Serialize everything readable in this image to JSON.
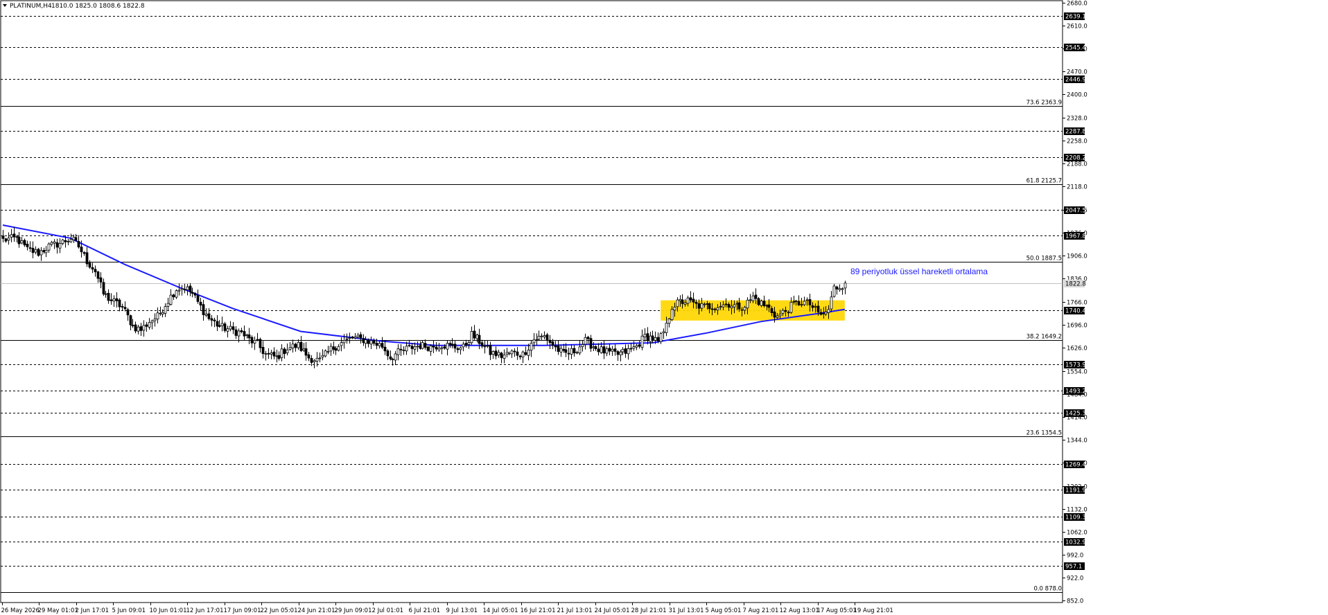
{
  "header": {
    "symbol": "PLATINUM,H4",
    "ohlc": "1810.0 1825.0 1808.6 1822.8"
  },
  "annotation": "89 periyotluk üssel hareketli ortalama",
  "chart_data": {
    "type": "candlestick",
    "title": "PLATINUM,H4",
    "ylim": [
      852,
      2680
    ],
    "current_price": 1822.8,
    "y_ticks": [
      2680.0,
      2610.0,
      2540.0,
      2470.0,
      2400.0,
      2328.0,
      2258.0,
      2188.0,
      2118.0,
      2047.5,
      1976.0,
      1906.0,
      1836.0,
      1766.0,
      1696.0,
      1626.0,
      1554.0,
      1484.0,
      1414.0,
      1344.0,
      1274.0,
      1202.0,
      1132.0,
      1062.0,
      992.0,
      922.0,
      852.0
    ],
    "x_labels": [
      "26 May 2026",
      "29 May 01:01",
      "2 Jun 17:01",
      "5 Jun 09:01",
      "10 Jun 01:01",
      "12 Jun 17:01",
      "17 Jun 09:01",
      "22 Jun 05:01",
      "24 Jun 21:01",
      "29 Jun 09:01",
      "2 Jul 01:01",
      "6 Jul 21:01",
      "9 Jul 13:01",
      "14 Jul 05:01",
      "16 Jul 21:01",
      "21 Jul 13:01",
      "24 Jul 05:01",
      "28 Jul 21:01",
      "31 Jul 13:01",
      "5 Aug 05:01",
      "7 Aug 21:01",
      "12 Aug 13:01",
      "17 Aug 05:01",
      "19 Aug 21:01"
    ],
    "levels": [
      {
        "value": 2639.1,
        "label": "2639.1"
      },
      {
        "value": 2545.4,
        "label": "2545.4"
      },
      {
        "value": 2446.9,
        "label": "2446.9"
      },
      {
        "value": 2287.8,
        "label": "2287.8"
      },
      {
        "value": 2208.2,
        "label": "2208.2"
      },
      {
        "value": 2047.5,
        "label": "2047.5"
      },
      {
        "value": 1967.8,
        "label": "1967.8"
      },
      {
        "value": 1740.4,
        "label": "1740.4"
      },
      {
        "value": 1573.9,
        "label": "1573.9"
      },
      {
        "value": 1493.2,
        "label": "1493.2"
      },
      {
        "value": 1425.3,
        "label": "1425.3"
      },
      {
        "value": 1269.4,
        "label": "1269.4"
      },
      {
        "value": 1191.9,
        "label": "1191.9"
      },
      {
        "value": 1109.3,
        "label": "1109.3"
      },
      {
        "value": 1032.9,
        "label": "1032.9"
      },
      {
        "value": 957.1,
        "label": "957.1"
      }
    ],
    "fibonacci": [
      {
        "value": 2363.9,
        "label": "73.6 2363.9"
      },
      {
        "value": 2125.7,
        "label": "61.8 2125.7"
      },
      {
        "value": 1887.5,
        "label": "50.0 1887.5"
      },
      {
        "value": 1649.2,
        "label": "38.2 1649.2"
      },
      {
        "value": 1354.5,
        "label": "23.6 1354.5"
      },
      {
        "value": 878.0,
        "label": "0.0 878.0"
      }
    ],
    "zone": {
      "from": 1708,
      "to": 1770,
      "x_start": 243,
      "x_end": 311,
      "color": "#ffd700"
    },
    "price_path": [
      [
        0,
        1955
      ],
      [
        5,
        1960
      ],
      [
        9,
        1925
      ],
      [
        13,
        1915
      ],
      [
        17,
        1935
      ],
      [
        21,
        1945
      ],
      [
        25,
        1960
      ],
      [
        28,
        1935
      ],
      [
        31,
        1890
      ],
      [
        34,
        1860
      ],
      [
        37,
        1790
      ],
      [
        40,
        1770
      ],
      [
        44,
        1750
      ],
      [
        48,
        1690
      ],
      [
        51,
        1680
      ],
      [
        54,
        1705
      ],
      [
        57,
        1720
      ],
      [
        61,
        1770
      ],
      [
        64,
        1805
      ],
      [
        67,
        1810
      ],
      [
        70,
        1790
      ],
      [
        73,
        1750
      ],
      [
        76,
        1715
      ],
      [
        80,
        1690
      ],
      [
        84,
        1680
      ],
      [
        88,
        1670
      ],
      [
        91,
        1650
      ],
      [
        94,
        1635
      ],
      [
        97,
        1605
      ],
      [
        101,
        1595
      ],
      [
        105,
        1625
      ],
      [
        109,
        1632
      ],
      [
        113,
        1595
      ],
      [
        117,
        1585
      ],
      [
        121,
        1620
      ],
      [
        125,
        1640
      ],
      [
        129,
        1655
      ],
      [
        133,
        1650
      ],
      [
        137,
        1640
      ],
      [
        140,
        1630
      ],
      [
        143,
        1595
      ],
      [
        146,
        1610
      ],
      [
        150,
        1625
      ],
      [
        154,
        1632
      ],
      [
        158,
        1628
      ],
      [
        162,
        1635
      ],
      [
        166,
        1628
      ],
      [
        170,
        1625
      ],
      [
        173,
        1665
      ],
      [
        176,
        1645
      ],
      [
        180,
        1610
      ],
      [
        184,
        1600
      ],
      [
        188,
        1610
      ],
      [
        192,
        1605
      ],
      [
        196,
        1650
      ],
      [
        200,
        1660
      ],
      [
        204,
        1625
      ],
      [
        207,
        1605
      ],
      [
        211,
        1615
      ],
      [
        215,
        1645
      ],
      [
        219,
        1625
      ],
      [
        223,
        1610
      ],
      [
        227,
        1605
      ],
      [
        231,
        1615
      ],
      [
        234,
        1630
      ],
      [
        237,
        1660
      ],
      [
        240,
        1655
      ],
      [
        242,
        1640
      ],
      [
        245,
        1690
      ],
      [
        247,
        1752
      ],
      [
        250,
        1765
      ],
      [
        253,
        1768
      ],
      [
        256,
        1755
      ],
      [
        259,
        1750
      ],
      [
        262,
        1752
      ],
      [
        265,
        1755
      ],
      [
        268,
        1760
      ],
      [
        271,
        1750
      ],
      [
        274,
        1755
      ],
      [
        277,
        1780
      ],
      [
        280,
        1760
      ],
      [
        283,
        1745
      ],
      [
        286,
        1720
      ],
      [
        289,
        1738
      ],
      [
        292,
        1758
      ],
      [
        295,
        1765
      ],
      [
        298,
        1758
      ],
      [
        301,
        1730
      ],
      [
        303,
        1725
      ],
      [
        305,
        1742
      ],
      [
        307,
        1808
      ],
      [
        309,
        1812
      ],
      [
        311,
        1822.8
      ]
    ],
    "moving_average": {
      "name": "89 periyotluk üssel hareketli ortalama",
      "color": "#1a1aff",
      "points": [
        [
          0,
          2000
        ],
        [
          25,
          1960
        ],
        [
          45,
          1880
        ],
        [
          65,
          1810
        ],
        [
          85,
          1745
        ],
        [
          110,
          1675
        ],
        [
          140,
          1645
        ],
        [
          160,
          1632
        ],
        [
          200,
          1632
        ],
        [
          240,
          1640
        ],
        [
          260,
          1670
        ],
        [
          280,
          1705
        ],
        [
          300,
          1728
        ],
        [
          311,
          1742
        ]
      ]
    }
  }
}
